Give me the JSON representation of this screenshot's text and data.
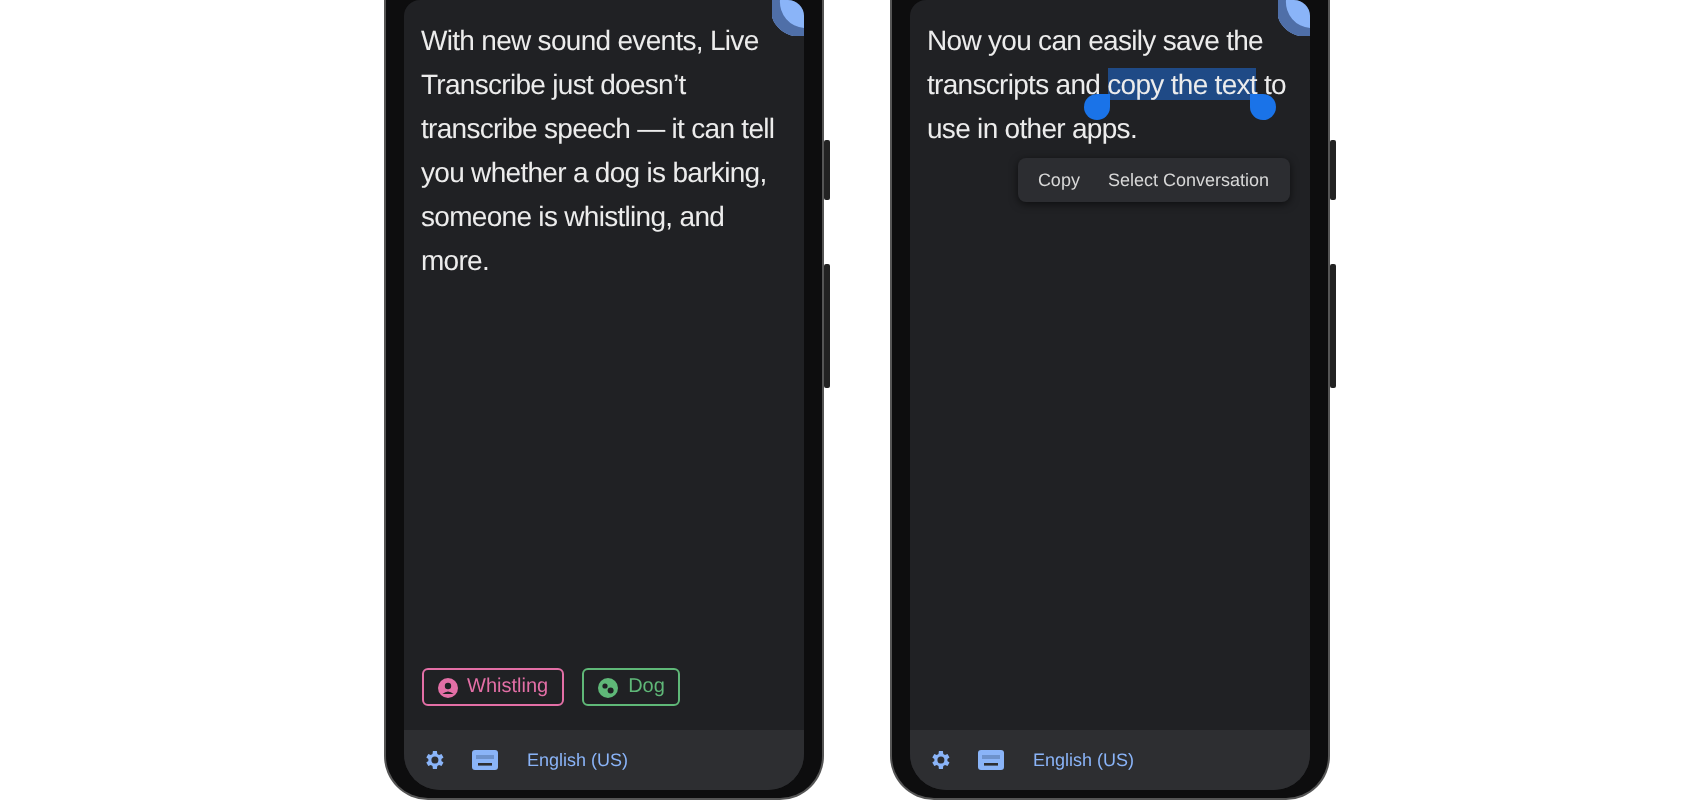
{
  "phones": [
    {
      "transcript": [
        {
          "text": "With new sound events, Live Transcribe just doesn’t transcribe speech — it can tell you whether a dog is barking, someone is whistling, and more.",
          "selected": false
        }
      ],
      "chips": [
        {
          "label": "Whistling",
          "kind": "person",
          "color": "#e36fa6"
        },
        {
          "label": "Dog",
          "kind": "dog",
          "color": "#5fb878"
        }
      ],
      "language": "English (US)"
    },
    {
      "transcript": [
        {
          "text": "Now you can easily save the transcripts and ",
          "selected": false
        },
        {
          "text": "copy the text",
          "selected": true
        },
        {
          "text": " to use in other apps.",
          "selected": false
        }
      ],
      "menu": [
        "Copy",
        "Select Conversation"
      ],
      "language": "English (US)"
    }
  ]
}
